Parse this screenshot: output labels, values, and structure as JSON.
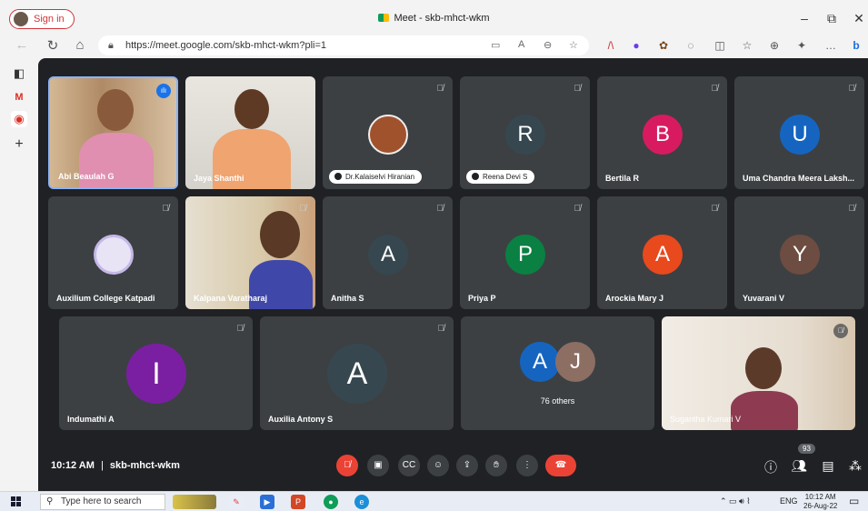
{
  "browser": {
    "signin_label": "Sign in",
    "window_title": "Meet - skb-mhct-wkm",
    "url": "https://meet.google.com/skb-mhct-wkm?pli=1",
    "controls": {
      "minimize": "–",
      "restore": "⧉",
      "close": "✕"
    }
  },
  "meeting": {
    "time": "10:12 AM",
    "separator": "|",
    "code": "skb-mhct-wkm",
    "participant_count": "93",
    "others_label": "76 others"
  },
  "participants": {
    "abi": "Abi Beaulah G",
    "jaya": "Jaya Shanthi",
    "kalai": "Dr.Kalaiselvi Hiranian",
    "reena": "Reena Devi S",
    "bertila": {
      "name": "Bertila R",
      "initial": "B",
      "color": "#d81b60"
    },
    "uma": {
      "name": "Uma Chandra Meera Laksh...",
      "initial": "U",
      "color": "#1565c0"
    },
    "auxilium": "Auxilium College Katpadi",
    "kalpana": "Kalpana Varatharaj",
    "anitha": {
      "name": "Anitha S",
      "initial": "A",
      "color": "#37474f"
    },
    "priya": {
      "name": "Priya P",
      "initial": "P",
      "color": "#0b8043"
    },
    "arockia": {
      "name": "Arockia Mary J",
      "initial": "A",
      "color": "#e8491d"
    },
    "yuvarani": {
      "name": "Yuvarani V",
      "initial": "Y",
      "color": "#6d4c41"
    },
    "indumathi": {
      "name": "Indumathi A",
      "initial": "I",
      "color": "#7b1fa2"
    },
    "auxilia": {
      "name": "Auxilia Antony S",
      "initial": "A",
      "color": "#37474f"
    },
    "others_a": {
      "initial": "A",
      "color": "#1565c0"
    },
    "others_j": {
      "initial": "J",
      "color": "#8d6e63"
    },
    "sugantha": "Sugantha Kumari V",
    "reena_initial": "R",
    "reena_color": "#37474f"
  },
  "taskbar": {
    "search_placeholder": "Type here to search",
    "lang": "ENG",
    "time": "10:12 AM",
    "date": "26-Aug-22"
  }
}
